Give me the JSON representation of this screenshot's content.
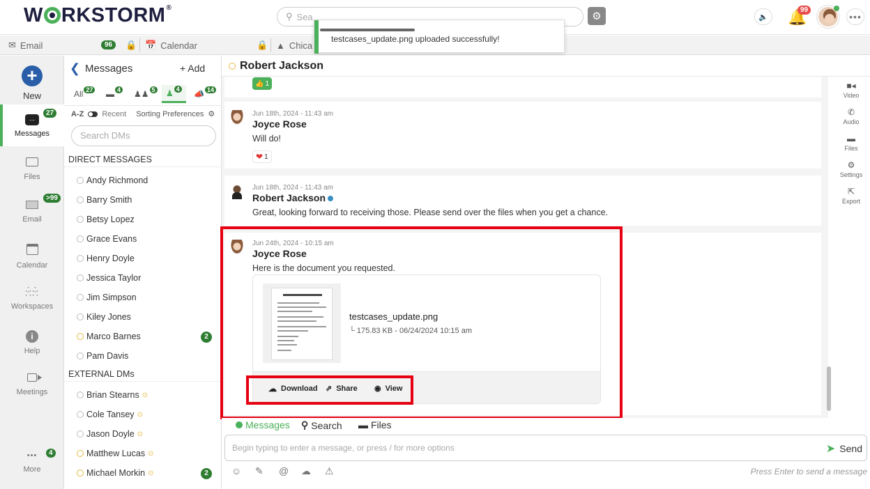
{
  "app": {
    "logo_text_left": "W",
    "logo_text_right": "RKSTORM",
    "logo_reg": "®",
    "search_placeholder": "Sea",
    "notifications_count": "99",
    "more_glyph": "•••"
  },
  "tabs": [
    {
      "label": "Email",
      "badge": "96"
    },
    {
      "label": "Calendar"
    },
    {
      "label": "Chica"
    }
  ],
  "toast": {
    "message": "testcases_update.png uploaded successfully!",
    "progress": 0.38
  },
  "leftnav": {
    "new_label": "New",
    "messages_label": "Messages",
    "messages_badge": "27",
    "files_label": "Files",
    "email_label": "Email",
    "email_badge": ">99",
    "calendar_label": "Calendar",
    "workspaces_label": "Workspaces",
    "help_label": "Help",
    "meetings_label": "Meetings",
    "more_label": "More",
    "more_badge": "4",
    "more_glyph": "•••"
  },
  "messages_panel": {
    "title": "Messages",
    "add_label": "+ Add",
    "filters": [
      {
        "label": "All",
        "badge": "27"
      },
      {
        "label": "",
        "badge": "4"
      },
      {
        "label": "",
        "badge": "5"
      },
      {
        "label": "",
        "badge": "4"
      },
      {
        "label": "",
        "badge": "14"
      }
    ],
    "sort_az": "A-Z",
    "sort_recent": "Recent",
    "sort_prefs": "Sorting Preferences",
    "search_placeholder": "Search DMs",
    "direct_header": "DIRECT MESSAGES",
    "direct": [
      {
        "name": "Andy Richmond"
      },
      {
        "name": "Barry Smith"
      },
      {
        "name": "Betsy Lopez"
      },
      {
        "name": "Grace Evans"
      },
      {
        "name": "Henry Doyle"
      },
      {
        "name": "Jessica Taylor"
      },
      {
        "name": "Jim Simpson"
      },
      {
        "name": "Kiley Jones"
      },
      {
        "name": "Marco Barnes",
        "unread": "2"
      },
      {
        "name": "Pam Davis"
      }
    ],
    "external_header": "EXTERNAL DMs",
    "external": [
      {
        "name": "Brian Stearns"
      },
      {
        "name": "Cole Tansey"
      },
      {
        "name": "Jason Doyle"
      },
      {
        "name": "Matthew Lucas"
      },
      {
        "name": "Michael Morkin",
        "unread": "2"
      }
    ]
  },
  "chat": {
    "title": "Robert Jackson",
    "top_reaction": "1",
    "messages": [
      {
        "time": "Jun 18th, 2024 - 11:43 am",
        "sender": "Joyce Rose",
        "text": "Will do!",
        "reaction_count": "1"
      },
      {
        "time": "Jun 18th, 2024 - 11:43 am",
        "sender": "Robert Jackson",
        "text": "Great, looking forward to receiving those. Please send over the files when you get a chance."
      },
      {
        "time": "Jun 24th, 2024 - 10:15 am",
        "sender": "Joyce Rose",
        "text": "Here is the document you requested.",
        "file": {
          "name": "testcases_update.png",
          "meta": "175.83 KB - 06/24/2024 10:15 am",
          "meta_prefix": "└ ",
          "download_label": "Download",
          "share_label": "Share",
          "view_label": "View"
        }
      }
    ]
  },
  "rightrail": [
    {
      "label": "Video",
      "icon": "video-icon",
      "glyph": "■◂"
    },
    {
      "label": "Audio",
      "icon": "phone-icon",
      "glyph": "✆"
    },
    {
      "label": "Files",
      "icon": "folder-icon",
      "glyph": "▬"
    },
    {
      "label": "Settings",
      "icon": "gear-icon",
      "glyph": "⚙"
    },
    {
      "label": "Export",
      "icon": "export-icon",
      "glyph": "⇱"
    }
  ],
  "composer": {
    "tab_messages": "Messages",
    "tab_search": "Search",
    "tab_files": "Files",
    "placeholder": "Begin typing to enter a message, or press / for more options",
    "send_label": "Send",
    "hint": "Press Enter to send a message"
  },
  "colors": {
    "accent_green": "#4bb05a",
    "badge_green": "#2e7d32",
    "brand_blue": "#2a5ea8",
    "highlight_red": "#e60012"
  }
}
